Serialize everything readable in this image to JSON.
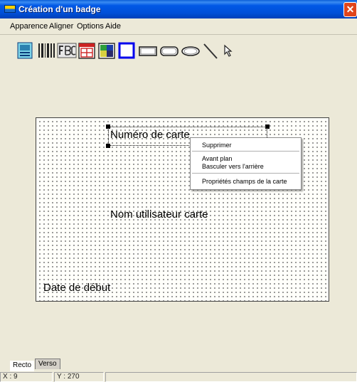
{
  "window": {
    "title": "Création d'un badge",
    "close_glyph": "✕"
  },
  "menu": [
    "Apparence",
    "Aligner",
    "Options",
    "Aide"
  ],
  "toolbar": {
    "tools": [
      {
        "name": "photo-field-icon"
      },
      {
        "name": "barcode-icon"
      },
      {
        "name": "text-field-icon"
      },
      {
        "name": "date-field-icon"
      },
      {
        "name": "image-icon"
      },
      {
        "name": "square-icon"
      },
      {
        "name": "rectangle-icon"
      },
      {
        "name": "rounded-rectangle-icon"
      },
      {
        "name": "ellipse-icon"
      },
      {
        "name": "line-icon"
      },
      {
        "name": "pointer-icon"
      }
    ]
  },
  "card": {
    "fields": [
      {
        "name": "card-number-field",
        "text": "Numéro de carte"
      },
      {
        "name": "card-user-name-field",
        "text": "Nom utilisateur carte"
      },
      {
        "name": "start-date-field",
        "text": "Date de début"
      }
    ]
  },
  "context_menu": {
    "items": [
      "Supprimer",
      "Avant plan",
      "Basculer vers l'arrière",
      "Propriétés champs de la carte"
    ]
  },
  "tabs": [
    {
      "label": "Recto",
      "active": true
    },
    {
      "label": "Verso",
      "active": false
    }
  ],
  "status": {
    "x": "X : 9",
    "y": "Y : 270"
  },
  "colors": {
    "titlebar": "#0058e6",
    "window_bg": "#ece9d8",
    "selection_accent": "#0000ff"
  }
}
